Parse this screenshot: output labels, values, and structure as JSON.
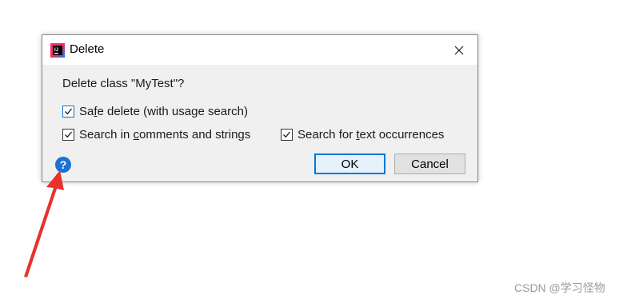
{
  "dialog": {
    "title": "Delete",
    "question": "Delete class \"MyTest\"?",
    "safe_delete": {
      "label_pre": "Sa",
      "label_mnemonic": "f",
      "label_post": "e delete (with usage search)",
      "checked": true
    },
    "search_comments": {
      "label_pre": "Search in ",
      "label_mnemonic": "c",
      "label_post": "omments and strings",
      "checked": true
    },
    "search_text": {
      "label_pre": "Search for ",
      "label_mnemonic": "t",
      "label_post": "ext occurrences",
      "checked": true
    },
    "ok_label": "OK",
    "cancel_label": "Cancel",
    "help_glyph": "?",
    "close_icon": "close-icon",
    "app_icon": "intellij-app-icon"
  },
  "annotation": {
    "arrow_color": "#e8322b"
  },
  "watermark": {
    "text": "CSDN @学习怪物"
  },
  "colors": {
    "accent": "#0078d7",
    "help_blue": "#1a73d1"
  }
}
